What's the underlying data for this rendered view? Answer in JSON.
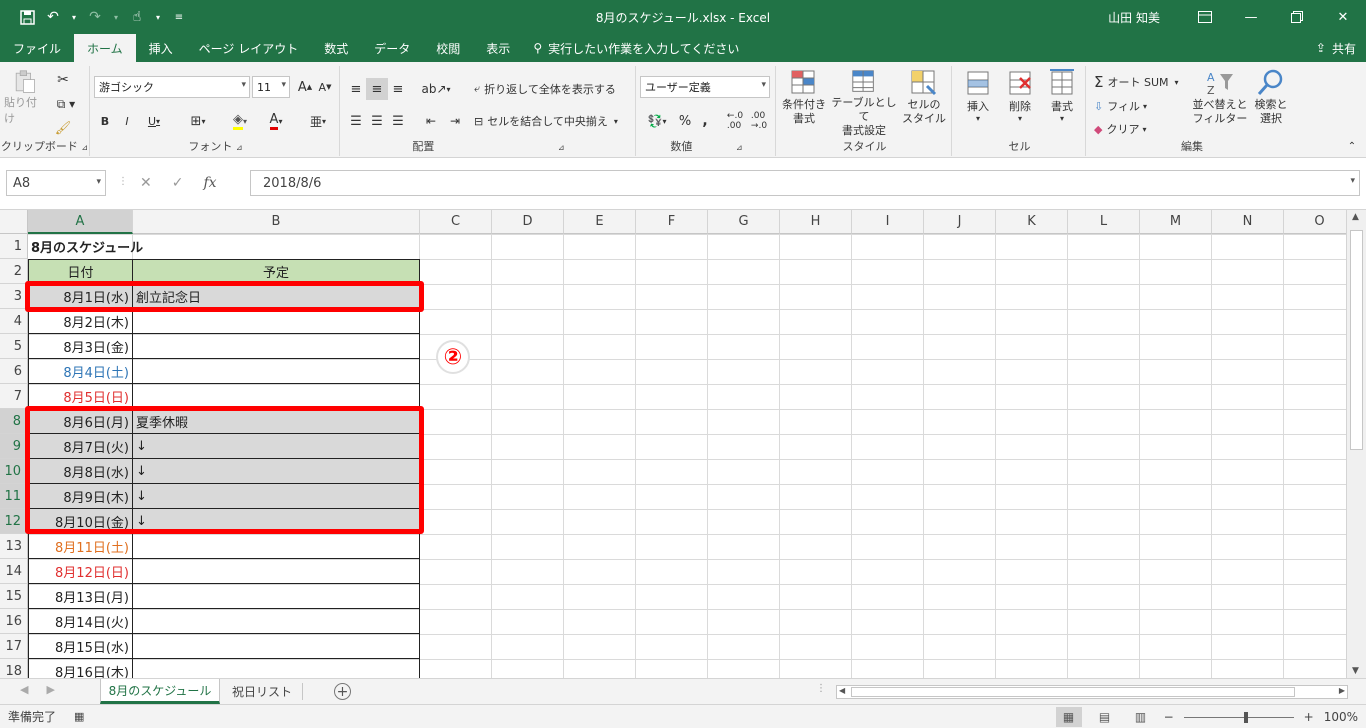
{
  "window": {
    "title": "8月のスケジュール.xlsx - Excel",
    "user": "山田 知美"
  },
  "tabs": [
    "ファイル",
    "ホーム",
    "挿入",
    "ページ レイアウト",
    "数式",
    "データ",
    "校閲",
    "表示"
  ],
  "active_tab": "ホーム",
  "tell_me": "実行したい作業を入力してください",
  "share": "共有",
  "ribbon": {
    "clipboard": {
      "paste": "貼り付け",
      "label": "クリップボード"
    },
    "font": {
      "name": "游ゴシック",
      "size": "11",
      "label": "フォント"
    },
    "alignment": {
      "wrap": "折り返して全体を表示する",
      "merge": "セルを結合して中央揃え",
      "label": "配置"
    },
    "number": {
      "format": "ユーザー定義",
      "label": "数値"
    },
    "styles": {
      "conditional": "条件付き\n書式",
      "table": "テーブルとして\n書式設定",
      "cell": "セルの\nスタイル",
      "label": "スタイル"
    },
    "cells": {
      "insert": "挿入",
      "delete": "削除",
      "format": "書式",
      "label": "セル"
    },
    "editing": {
      "autosum": "オート SUM",
      "fill": "フィル",
      "clear": "クリア",
      "sort": "並べ替えと\nフィルター",
      "find": "検索と\n選択",
      "label": "編集"
    }
  },
  "formula_bar": {
    "name_box": "A8",
    "fx": "fx",
    "value": "2018/8/6"
  },
  "columns": [
    "A",
    "B",
    "C",
    "D",
    "E",
    "F",
    "G",
    "H",
    "I",
    "J",
    "K",
    "L",
    "M",
    "N",
    "O"
  ],
  "sheet": {
    "title": "8月のスケジュール",
    "header_date": "日付",
    "header_plan": "予定",
    "rows": [
      {
        "date": "8月1日(水)",
        "plan": "創立記念日",
        "color": "#222222"
      },
      {
        "date": "8月2日(木)",
        "plan": "",
        "color": "#222222"
      },
      {
        "date": "8月3日(金)",
        "plan": "",
        "color": "#222222"
      },
      {
        "date": "8月4日(土)",
        "plan": "",
        "color": "#2e75b6"
      },
      {
        "date": "8月5日(日)",
        "plan": "",
        "color": "#e03030"
      },
      {
        "date": "8月6日(月)",
        "plan": "夏季休暇",
        "color": "#222222"
      },
      {
        "date": "8月7日(火)",
        "plan": "↓",
        "color": "#222222"
      },
      {
        "date": "8月8日(水)",
        "plan": "↓",
        "color": "#222222"
      },
      {
        "date": "8月9日(木)",
        "plan": "↓",
        "color": "#222222"
      },
      {
        "date": "8月10日(金)",
        "plan": "↓",
        "color": "#222222"
      },
      {
        "date": "8月11日(土)",
        "plan": "",
        "color": "#e07020"
      },
      {
        "date": "8月12日(日)",
        "plan": "",
        "color": "#e03030"
      },
      {
        "date": "8月13日(月)",
        "plan": "",
        "color": "#222222"
      },
      {
        "date": "8月14日(火)",
        "plan": "",
        "color": "#222222"
      },
      {
        "date": "8月15日(水)",
        "plan": "",
        "color": "#222222"
      },
      {
        "date": "8月16日(木)",
        "plan": "",
        "color": "#222222"
      }
    ]
  },
  "annotation": "②",
  "sheet_tabs": [
    "8月のスケジュール",
    "祝日リスト"
  ],
  "status": {
    "ready": "準備完了",
    "zoom": "100%"
  },
  "colors": {
    "excel_green": "#217346",
    "header_fill": "#c6e0b4",
    "highlight_fill": "#d9d9d9",
    "annotation_red": "#ff0000"
  }
}
